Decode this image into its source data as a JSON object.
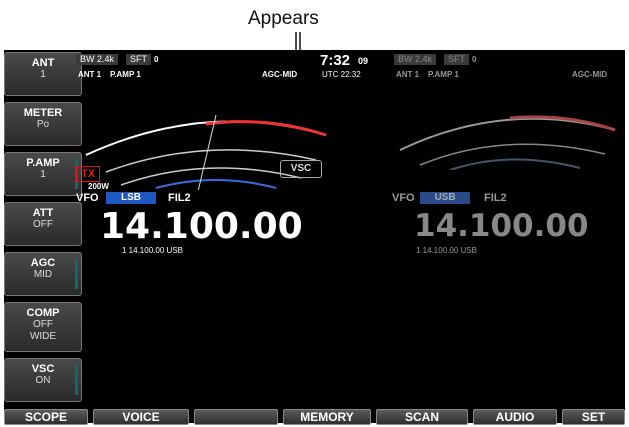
{
  "callout": "Appears",
  "side_buttons": [
    {
      "label": "ANT",
      "value": "1"
    },
    {
      "label": "METER",
      "value": "Po"
    },
    {
      "label": "P.AMP",
      "value": "1"
    },
    {
      "label": "ATT",
      "value": "OFF"
    },
    {
      "label": "AGC",
      "value": "MID"
    },
    {
      "label": "COMP",
      "value": "OFF WIDE"
    },
    {
      "label": "VSC",
      "value": "ON"
    }
  ],
  "bottom_buttons": [
    "SCOPE",
    "VOICE",
    "",
    "MEMORY",
    "SCAN",
    "AUDIO",
    "SET"
  ],
  "left": {
    "bw": "BW 2.4k",
    "sft": "SFT",
    "sft_val": "0",
    "ant": "ANT 1",
    "pamp": "P.AMP 1",
    "agc": "AGC-MID",
    "tx": "TX",
    "power": "200W",
    "vfo": "VFO",
    "mode": "LSB",
    "fil": "FIL2",
    "freq": "14.100.00",
    "sub": "1  14.100.00  USB",
    "vsc": "VSC"
  },
  "clock": {
    "time": "7:32",
    "sec": "09",
    "utc": "UTC 22:32"
  },
  "right": {
    "bw": "BW 2.4k",
    "sft": "SFT",
    "sft_val": "0",
    "ant": "ANT 1",
    "pamp": "P.AMP 1",
    "agc": "AGC-MID",
    "vfo": "VFO",
    "mode": "USB",
    "fil": "FIL2",
    "freq": "14.100.00",
    "sub": "1  14.100.00  USB"
  },
  "colors": {
    "accent_blue": "#1f58c2",
    "tx_red": "#d11",
    "meter_red": "#e33"
  }
}
